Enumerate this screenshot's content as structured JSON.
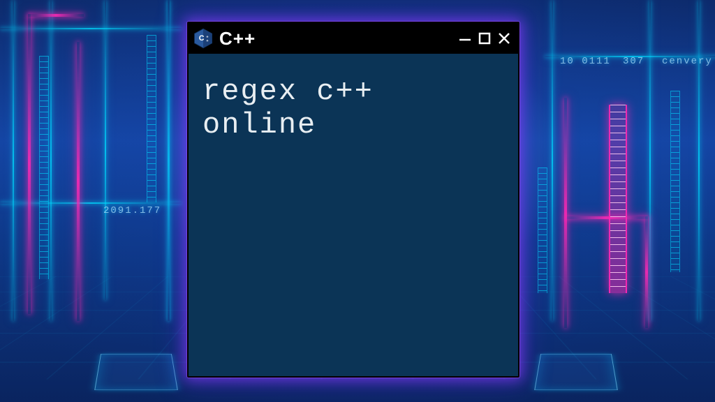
{
  "window": {
    "title": "C++",
    "icon": "cpp-hex-icon"
  },
  "editor": {
    "content": "regex c++\nonline"
  },
  "background": {
    "text_left": "2091.177",
    "text_right_a": "10 0111",
    "text_right_b": "307",
    "text_right_c": "cenvery"
  }
}
